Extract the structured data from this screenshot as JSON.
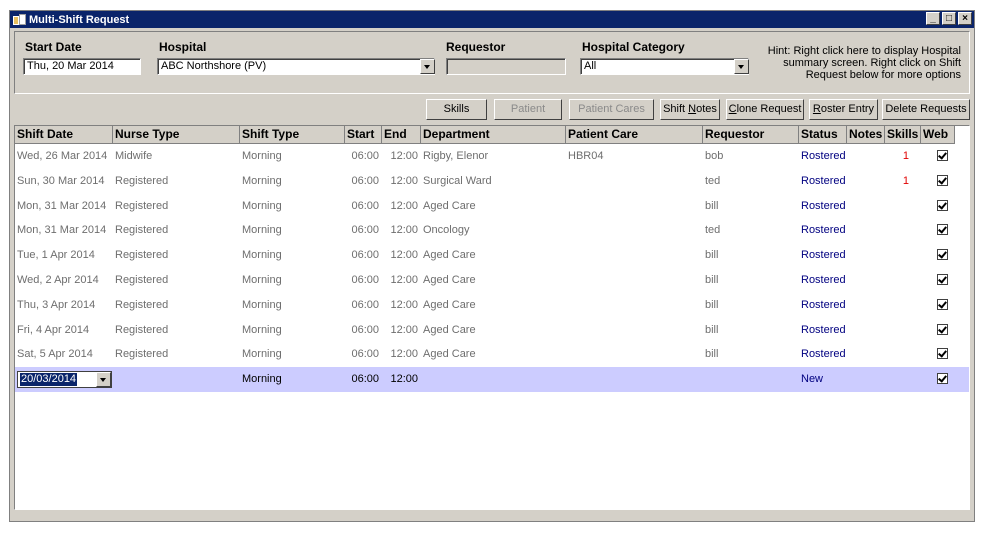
{
  "window": {
    "title": "Multi-Shift Request"
  },
  "header": {
    "start_date_label": "Start Date",
    "start_date_value": "Thu, 20 Mar 2014",
    "hospital_label": "Hospital",
    "hospital_value": "ABC Northshore  (PV)",
    "requestor_label": "Requestor",
    "requestor_value": "",
    "category_label": "Hospital Category",
    "category_value": "All",
    "hint": "Hint: Right click here to display Hospital summary screen. Right click on Shift Request below for more options"
  },
  "toolbar": {
    "skills": "Skills",
    "patient": "Patient",
    "patient_cares": "Patient Cares",
    "shift_notes_pre": "Shift ",
    "shift_notes_u": "N",
    "shift_notes_post": "otes",
    "clone_u": "C",
    "clone_post": "lone Request",
    "roster_u": "R",
    "roster_post": "oster Entry",
    "delete": "Delete Requests"
  },
  "columns": [
    "Shift Date",
    "Nurse Type",
    "Shift Type",
    "Start",
    "End",
    "Department",
    "Patient Care",
    "Requestor",
    "Status",
    "Notes",
    "Skills",
    "Web"
  ],
  "rows": [
    {
      "date": "Wed, 26 Mar 2014",
      "nurse": "Midwife",
      "shift": "Morning",
      "start": "06:00",
      "end": "12:00",
      "dept": "Rigby, Elenor",
      "care": "HBR04",
      "req": "bob",
      "status": "Rostered",
      "notes": "",
      "skills": "1",
      "web": true
    },
    {
      "date": "Sun, 30 Mar 2014",
      "nurse": "Registered",
      "shift": "Morning",
      "start": "06:00",
      "end": "12:00",
      "dept": "Surgical Ward",
      "care": "",
      "req": "ted",
      "status": "Rostered",
      "notes": "",
      "skills": "1",
      "web": true
    },
    {
      "date": "Mon, 31 Mar 2014",
      "nurse": "Registered",
      "shift": "Morning",
      "start": "06:00",
      "end": "12:00",
      "dept": "Aged Care",
      "care": "",
      "req": "bill",
      "status": "Rostered",
      "notes": "",
      "skills": "",
      "web": true
    },
    {
      "date": "Mon, 31 Mar 2014",
      "nurse": "Registered",
      "shift": "Morning",
      "start": "06:00",
      "end": "12:00",
      "dept": "Oncology",
      "care": "",
      "req": "ted",
      "status": "Rostered",
      "notes": "",
      "skills": "",
      "web": true
    },
    {
      "date": "Tue, 1 Apr 2014",
      "nurse": "Registered",
      "shift": "Morning",
      "start": "06:00",
      "end": "12:00",
      "dept": "Aged Care",
      "care": "",
      "req": "bill",
      "status": "Rostered",
      "notes": "",
      "skills": "",
      "web": true
    },
    {
      "date": "Wed, 2 Apr 2014",
      "nurse": "Registered",
      "shift": "Morning",
      "start": "06:00",
      "end": "12:00",
      "dept": "Aged Care",
      "care": "",
      "req": "bill",
      "status": "Rostered",
      "notes": "",
      "skills": "",
      "web": true
    },
    {
      "date": "Thu, 3 Apr 2014",
      "nurse": "Registered",
      "shift": "Morning",
      "start": "06:00",
      "end": "12:00",
      "dept": "Aged Care",
      "care": "",
      "req": "bill",
      "status": "Rostered",
      "notes": "",
      "skills": "",
      "web": true
    },
    {
      "date": "Fri, 4 Apr 2014",
      "nurse": "Registered",
      "shift": "Morning",
      "start": "06:00",
      "end": "12:00",
      "dept": "Aged Care",
      "care": "",
      "req": "bill",
      "status": "Rostered",
      "notes": "",
      "skills": "",
      "web": true
    },
    {
      "date": "Sat, 5 Apr 2014",
      "nurse": "Registered",
      "shift": "Morning",
      "start": "06:00",
      "end": "12:00",
      "dept": "Aged Care",
      "care": "",
      "req": "bill",
      "status": "Rostered",
      "notes": "",
      "skills": "",
      "web": true
    }
  ],
  "new_row": {
    "date": "20/03/2014",
    "shift": "Morning",
    "start": "06:00",
    "end": "12:00",
    "status": "New",
    "web": true
  },
  "icons": {
    "app": "app-icon",
    "minimize": "minimize-icon",
    "maximize": "maximize-icon",
    "close": "close-icon"
  }
}
